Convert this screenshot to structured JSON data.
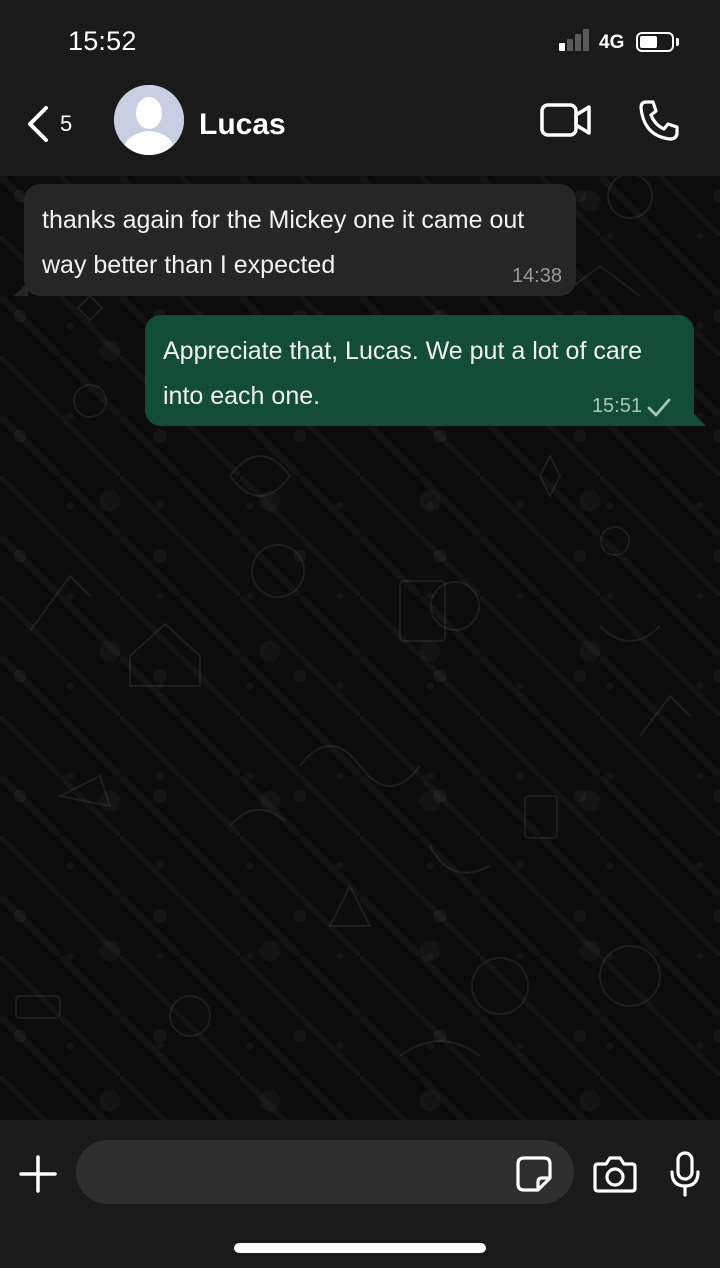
{
  "status_bar": {
    "time": "15:52",
    "network": "4G",
    "signal_bars_filled": 1,
    "signal_bars_total": 4,
    "battery_level": 0.55
  },
  "header": {
    "back_count": "5",
    "contact_name": "Lucas",
    "icons": {
      "back": "chevron-left-icon",
      "avatar": "default-avatar-icon",
      "video": "video-camera-icon",
      "call": "phone-icon"
    }
  },
  "messages": [
    {
      "direction": "incoming",
      "text": "thanks again for the Mickey one it came out way better than I expected",
      "time": "14:38"
    },
    {
      "direction": "outgoing",
      "text": "Appreciate that, Lucas. We put a lot of care into each one.",
      "time": "15:51",
      "status": "sent"
    }
  ],
  "composer": {
    "input_value": "",
    "icons": [
      "plus-icon",
      "sticker-icon",
      "camera-icon",
      "microphone-icon"
    ]
  },
  "colors": {
    "bar_background": "#1a1a1a",
    "incoming_bubble": "#262626",
    "outgoing_bubble": "#134d37",
    "input_background": "#2e2e2e",
    "timestamp": "#9a9a9a"
  }
}
